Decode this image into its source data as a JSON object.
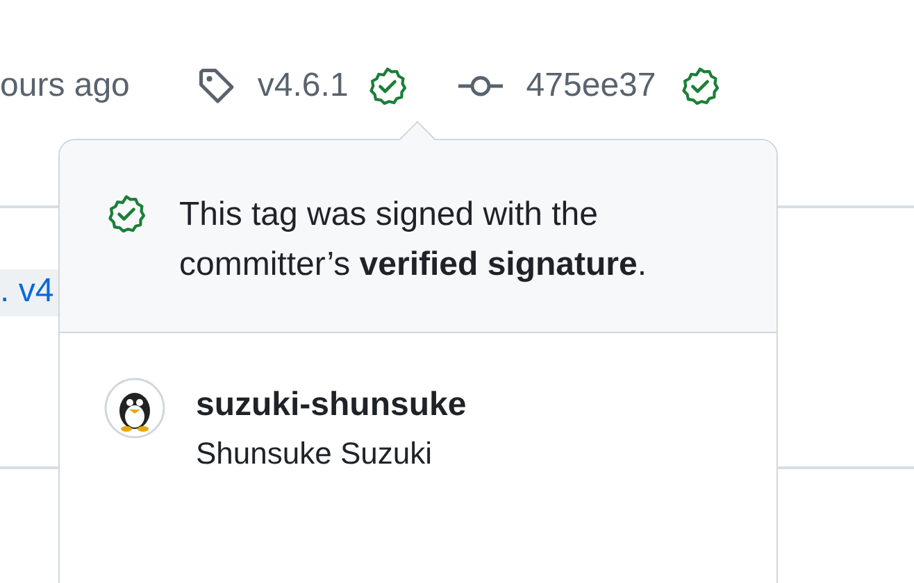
{
  "header": {
    "time_text": "ours ago",
    "tag": {
      "name": "v4.6.1",
      "verified": true
    },
    "commit": {
      "sha": "475ee37",
      "verified": true
    }
  },
  "background": {
    "link_text": ". v4"
  },
  "popover": {
    "verified": true,
    "message": "This tag was signed with the committer’s **verified signature**.",
    "user": {
      "login": "suzuki-shunsuke",
      "name": "Shunsuke Suzuki"
    }
  }
}
